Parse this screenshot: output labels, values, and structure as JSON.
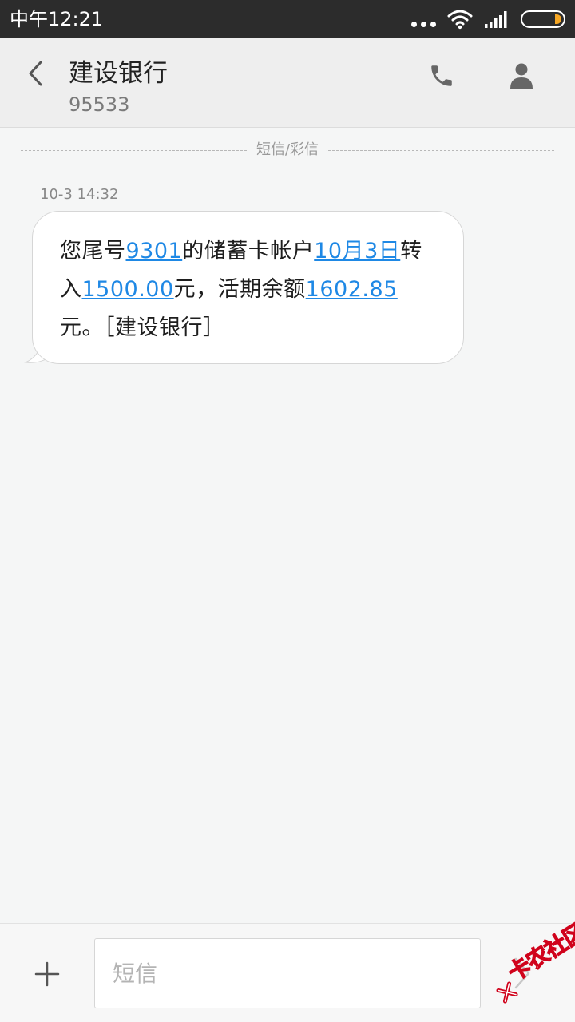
{
  "status_bar": {
    "time": "中午12:21",
    "icons": [
      "more-dots-icon",
      "wifi-icon",
      "signal-icon",
      "battery-icon"
    ]
  },
  "header": {
    "back_icon": "chevron-left-icon",
    "contact_name": "建设银行",
    "contact_number": "95533",
    "call_icon": "phone-icon",
    "contact_icon": "person-icon"
  },
  "conversation": {
    "divider_label": "短信/彩信",
    "messages": [
      {
        "time": "10-3 14:32",
        "segments": [
          {
            "text": "您尾号",
            "link": false
          },
          {
            "text": "9301",
            "link": true
          },
          {
            "text": "的储蓄卡帐户",
            "link": false
          },
          {
            "text": "10月3日",
            "link": true
          },
          {
            "text": "转入",
            "link": false
          },
          {
            "text": "1500.00",
            "link": true
          },
          {
            "text": "元，活期余额",
            "link": false
          },
          {
            "text": "1602.85",
            "link": true
          },
          {
            "text": "元。［建设银行］",
            "link": false
          }
        ]
      }
    ]
  },
  "composer": {
    "add_icon": "plus-icon",
    "placeholder": "短信",
    "value": "",
    "send_icon": "send-arrow-icon"
  },
  "watermark": {
    "text": "卡农社区",
    "color": "#d0021b"
  },
  "colors": {
    "link": "#1e88e5",
    "status_bar": "#2c2c2c",
    "battery_level": "#f5a623"
  }
}
